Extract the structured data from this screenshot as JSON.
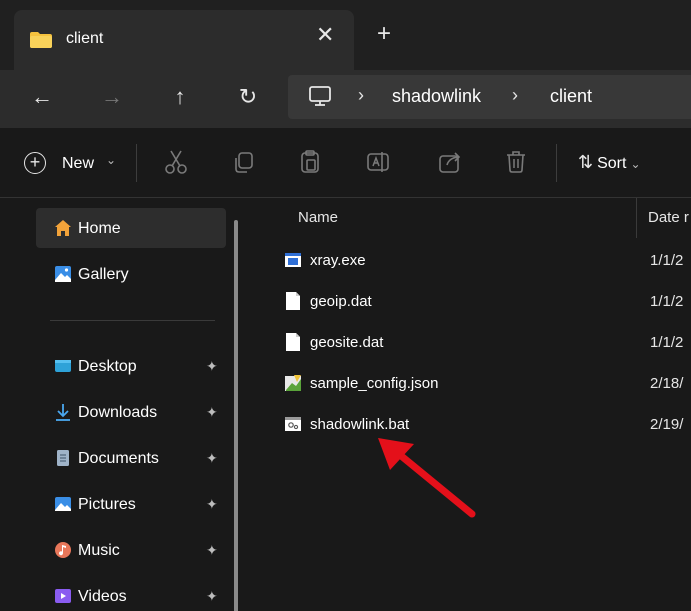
{
  "tab": {
    "title": "client",
    "close_glyph": "✕",
    "new_tab_glyph": "+"
  },
  "nav": {
    "back_glyph": "←",
    "forward_glyph": "→",
    "up_glyph": "↑",
    "refresh_glyph": "↻",
    "breadcrumbs": [
      "shadowlink",
      "client"
    ],
    "separator": "›"
  },
  "commands": {
    "new_label": "New",
    "sort_label": "Sort",
    "chevron": "⌄",
    "sort_glyph": "⇅"
  },
  "sidebar": {
    "top_items": [
      {
        "label": "Home",
        "icon": "home-icon",
        "selected": true
      },
      {
        "label": "Gallery",
        "icon": "gallery-icon",
        "selected": false
      }
    ],
    "pinned_items": [
      {
        "label": "Desktop",
        "icon": "desktop-folder-icon"
      },
      {
        "label": "Downloads",
        "icon": "download-icon"
      },
      {
        "label": "Documents",
        "icon": "documents-folder-icon"
      },
      {
        "label": "Pictures",
        "icon": "pictures-folder-icon"
      },
      {
        "label": "Music",
        "icon": "music-folder-icon"
      },
      {
        "label": "Videos",
        "icon": "videos-folder-icon"
      }
    ],
    "pin_glyph": "📌"
  },
  "files": {
    "columns": {
      "name": "Name",
      "date": "Date r"
    },
    "rows": [
      {
        "name": "xray.exe",
        "date": "1/1/2",
        "icon": "exe-icon"
      },
      {
        "name": "geoip.dat",
        "date": "1/1/2",
        "icon": "file-icon"
      },
      {
        "name": "geosite.dat",
        "date": "1/1/2",
        "icon": "file-icon"
      },
      {
        "name": "sample_config.json",
        "date": "2/18/",
        "icon": "json-icon"
      },
      {
        "name": "shadowlink.bat",
        "date": "2/19/",
        "icon": "batch-file-icon"
      }
    ]
  },
  "colors": {
    "background": "#191919",
    "titlebar": "#202020",
    "tab_active": "#2c2c2c",
    "folder_yellow": "#f6c23e",
    "annotation_arrow": "#e4101a"
  }
}
